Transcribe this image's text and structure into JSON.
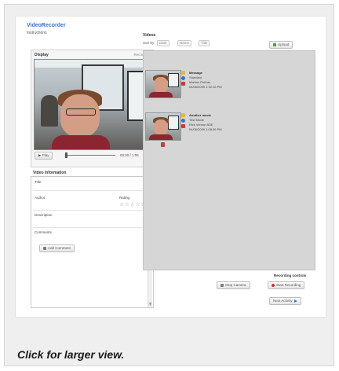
{
  "app": {
    "title": "VideoRecorder",
    "subtitle": "Instructions"
  },
  "display_panel": {
    "header": "Display",
    "link": "Recording",
    "play_label": "Play",
    "time": "00:00 / 1:06"
  },
  "video_info": {
    "title": "Video Information",
    "fields": {
      "title": "Title",
      "author": "Author",
      "rating": "Rating",
      "description": "Description",
      "comments": "Comments"
    },
    "rating_stars": "☆☆☆☆☆",
    "add_comment": "Add Comment"
  },
  "videos": {
    "title": "Videos",
    "sort_label": "Sort by",
    "sort_options": [
      "Date",
      "Name",
      "Title"
    ],
    "upload_label": "Upload",
    "items": [
      {
        "title": "Message",
        "line1": "Standard",
        "line2": "Markus Peßner",
        "line3": "04/06/2009 1:32:16 PM"
      },
      {
        "title": "Another movie",
        "line1": "Test Movie",
        "line2": "Rick Vernon ADE",
        "line3": "04/06/2009 1:08:06 PM"
      }
    ]
  },
  "recording_controls": {
    "label": "Recording controls",
    "stop_label": "Stop Camera",
    "start_label": "Start Recording"
  },
  "next_label": "Next Activity",
  "caption": "Click for larger view.",
  "colors": {
    "accent": "#3a73c4",
    "list_bg": "#d6d6d6",
    "shirt": "#8b2630"
  }
}
